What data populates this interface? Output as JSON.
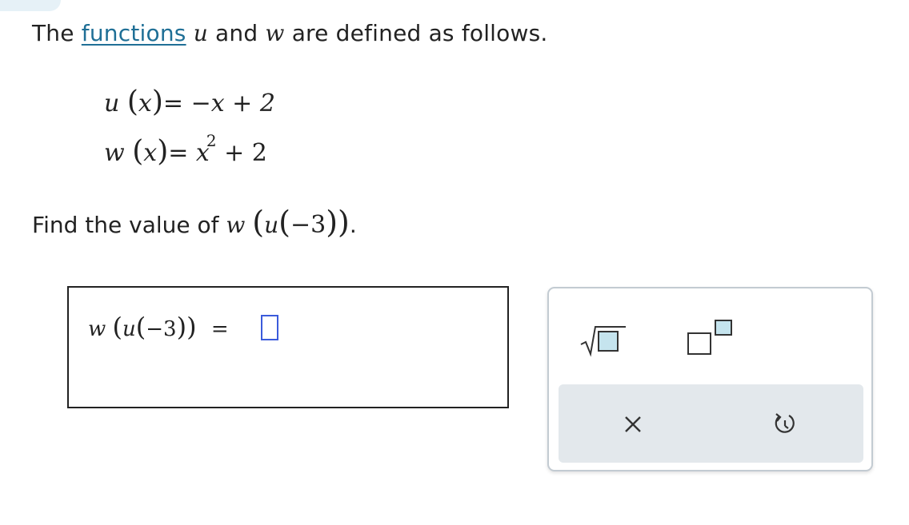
{
  "intro": {
    "text_before": "The",
    "link_text": "functions",
    "var_u": "u",
    "word_and": "and",
    "var_w": "w",
    "text_after": "are defined as follows."
  },
  "equations": {
    "u_name": "u",
    "u_arg": "x",
    "u_rhs": "= −x + 2",
    "w_name": "w",
    "w_arg": "x",
    "w_rhs_base": "= x",
    "w_rhs_exp": "2",
    "w_rhs_tail": " + 2"
  },
  "prompt": {
    "text": "Find the value of",
    "outer": "w",
    "inner": "u",
    "arg": "−3",
    "period": "."
  },
  "answer": {
    "outer": "w",
    "inner": "u",
    "arg": "−3",
    "equals": "=",
    "value": ""
  },
  "keypad": {
    "sqrt_icon": "sqrt-template-icon",
    "exponent_icon": "exponent-template-icon",
    "clear_icon": "close-icon",
    "undo_icon": "undo-icon"
  },
  "colors": {
    "link": "#1f6f96",
    "slot_border": "#3b5bdb",
    "key_fill": "#c5e4ee",
    "action_bar": "#e3e8ec"
  }
}
